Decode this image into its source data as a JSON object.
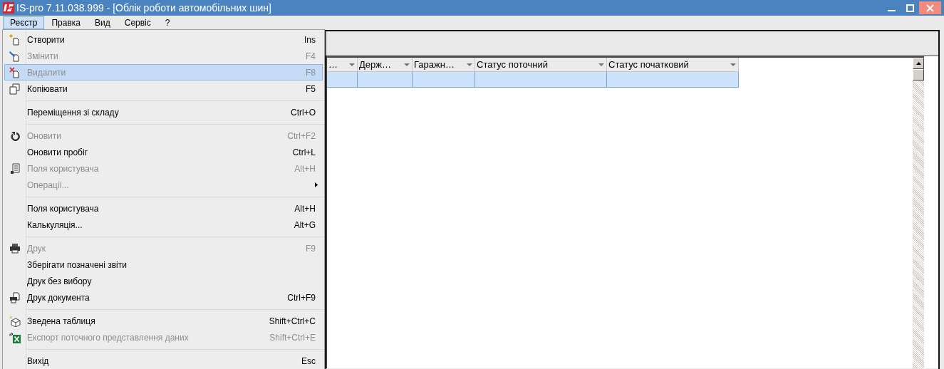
{
  "window": {
    "title": "IS-pro 7.11.038.999 - [Облік роботи автомобільних шин]"
  },
  "menu_bar": [
    {
      "label": "Реєстр",
      "selected": true
    },
    {
      "label": "Правка",
      "selected": false
    },
    {
      "label": "Вид",
      "selected": false
    },
    {
      "label": "Сервіс",
      "selected": false
    },
    {
      "label": "?",
      "selected": false
    }
  ],
  "dropdown": [
    {
      "kind": "item",
      "label": "Створити",
      "shortcut": "Ins",
      "disabled": false,
      "selected": false
    },
    {
      "kind": "item",
      "label": "Змінити",
      "shortcut": "F4",
      "disabled": true,
      "selected": false
    },
    {
      "kind": "item",
      "label": "Видалити",
      "shortcut": "F8",
      "disabled": true,
      "selected": true
    },
    {
      "kind": "item",
      "label": "Копіювати",
      "shortcut": "F5",
      "disabled": false,
      "selected": false
    },
    {
      "kind": "separator"
    },
    {
      "kind": "item",
      "label": "Переміщення зі складу",
      "shortcut": "Ctrl+O",
      "disabled": false,
      "selected": false
    },
    {
      "kind": "separator"
    },
    {
      "kind": "item",
      "label": "Оновити",
      "shortcut": "Ctrl+F2",
      "disabled": true,
      "selected": false
    },
    {
      "kind": "item",
      "label": "Оновити пробіг",
      "shortcut": "Ctrl+L",
      "disabled": false,
      "selected": false
    },
    {
      "kind": "item",
      "label": "Поля користувача",
      "shortcut": "Alt+H",
      "disabled": true,
      "selected": false
    },
    {
      "kind": "item",
      "label": "Операції...",
      "disabled": true,
      "selected": false,
      "submenu": true
    },
    {
      "kind": "separator"
    },
    {
      "kind": "item",
      "label": "Поля користувача",
      "shortcut": "Alt+H",
      "disabled": false,
      "selected": false
    },
    {
      "kind": "item",
      "label": "Калькуляція...",
      "shortcut": "Alt+G",
      "disabled": false,
      "selected": false
    },
    {
      "kind": "separator"
    },
    {
      "kind": "item",
      "label": "Друк",
      "shortcut": "F9",
      "disabled": true,
      "selected": false
    },
    {
      "kind": "item",
      "label": "Зберігати позначені звіти",
      "disabled": false,
      "selected": false
    },
    {
      "kind": "item",
      "label": "Друк без вибору",
      "disabled": false,
      "selected": false
    },
    {
      "kind": "item",
      "label": "Друк документа",
      "shortcut": "Ctrl+F9",
      "disabled": false,
      "selected": false
    },
    {
      "kind": "separator"
    },
    {
      "kind": "item",
      "label": "Зведена таблиця",
      "shortcut": "Shift+Ctrl+C",
      "disabled": false,
      "selected": false
    },
    {
      "kind": "item",
      "label": "Експорт поточного представлення даних",
      "shortcut": "Shift+Ctrl+E",
      "disabled": true,
      "selected": false
    },
    {
      "kind": "separator"
    },
    {
      "kind": "item",
      "label": "Вихід",
      "shortcut": "Esc",
      "disabled": false,
      "selected": false
    }
  ],
  "table": {
    "columns": [
      "…",
      "Держ…",
      "Гаражн…",
      "Статус поточний",
      "Статус початковий"
    ],
    "rows": [
      {
        "selected": true
      }
    ]
  }
}
